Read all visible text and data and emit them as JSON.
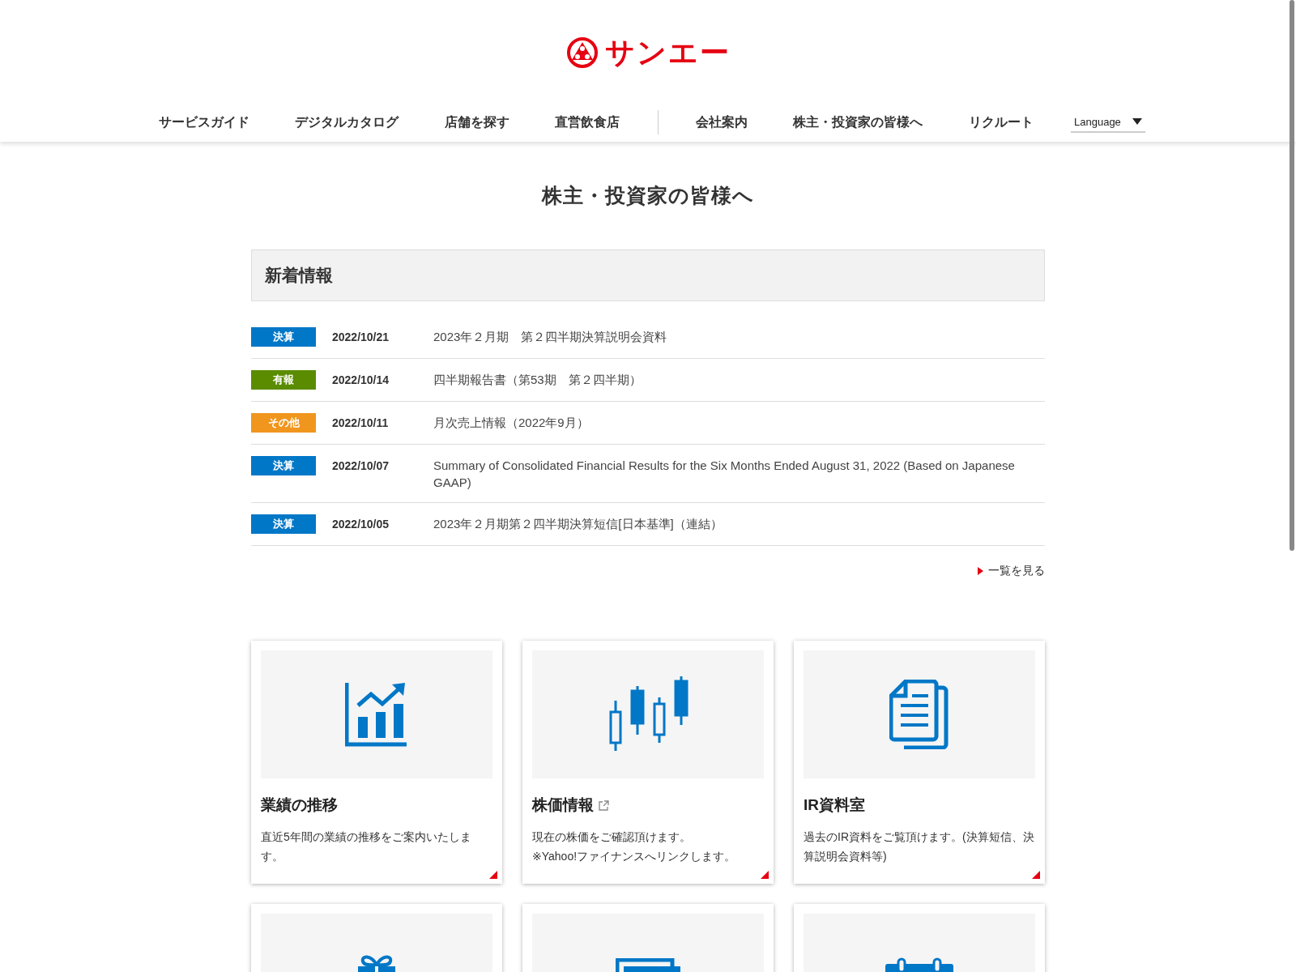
{
  "logo": {
    "text": "サンエー"
  },
  "nav": [
    {
      "label": "サービスガイド",
      "divider_after": false
    },
    {
      "label": "デジタルカタログ",
      "divider_after": false
    },
    {
      "label": "店舗を探す",
      "divider_after": false
    },
    {
      "label": "直営飲食店",
      "divider_after": true
    },
    {
      "label": "会社案内",
      "divider_after": false
    },
    {
      "label": "株主・投資家の皆様へ",
      "divider_after": false
    },
    {
      "label": "リクルート",
      "divider_after": false
    }
  ],
  "language": {
    "value": "Language"
  },
  "page_title": "株主・投資家の皆様へ",
  "news": {
    "heading": "新着情報",
    "items": [
      {
        "tag": "決算",
        "color": "#0077c7",
        "date": "2022/10/21",
        "text": "2023年２月期　第２四半期決算説明会資料"
      },
      {
        "tag": "有報",
        "color": "#5b8c00",
        "date": "2022/10/14",
        "text": "四半期報告書（第53期　第２四半期）"
      },
      {
        "tag": "その他",
        "color": "#f0961e",
        "date": "2022/10/11",
        "text": "月次売上情報（2022年9月）"
      },
      {
        "tag": "決算",
        "color": "#0077c7",
        "date": "2022/10/07",
        "text": "Summary of Consolidated Financial Results for the Six Months Ended August 31, 2022 (Based on Japanese GAAP)"
      },
      {
        "tag": "決算",
        "color": "#0077c7",
        "date": "2022/10/05",
        "text": "2023年２月期第２四半期決算短信[日本基準]（連結）"
      }
    ],
    "more_link": "一覧を見る"
  },
  "cards": [
    {
      "kind": "full",
      "title": "業績の推移",
      "external": false,
      "description": [
        "直近5年間の業績の推移をご案内いたします。"
      ]
    },
    {
      "kind": "full",
      "title": "株価情報",
      "external": true,
      "description": [
        "現在の株価をご確認頂けます。",
        "※Yahoo!ファイナンスへリンクします。"
      ]
    },
    {
      "kind": "full",
      "title": "IR資料室",
      "external": false,
      "description": [
        "過去のIR資料をご覧頂けます。(決算短信、決算説明会資料等)"
      ]
    },
    {
      "kind": "icon_only"
    },
    {
      "kind": "icon_only"
    },
    {
      "kind": "icon_only"
    }
  ]
}
